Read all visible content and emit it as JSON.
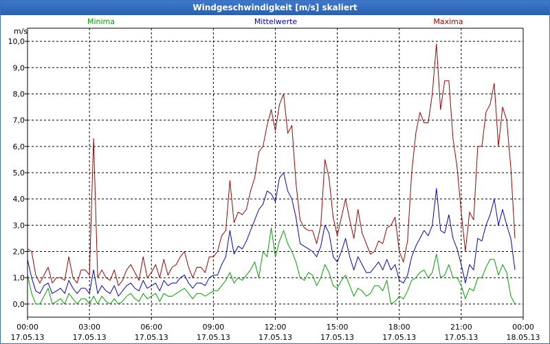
{
  "title": "Windgeschwindigkeit [m/s] skaliert",
  "colors": {
    "titlebar": "#2f68b8",
    "minima": "#00a000",
    "mittelwerte": "#0000c8",
    "maxima": "#a00000"
  },
  "chart_data": {
    "type": "line",
    "title": "Windgeschwindigkeit [m/s] skaliert",
    "ylabel": "m/s",
    "ylim": [
      -0.5,
      10.5
    ],
    "xlim": [
      0,
      24
    ],
    "grid": true,
    "legend_placement": "top",
    "y_ticks": [
      "0,0",
      "1,0",
      "2,0",
      "3,0",
      "4,0",
      "5,0",
      "6,0",
      "7,0",
      "8,0",
      "9,0",
      "10,0"
    ],
    "x_ticks": [
      {
        "time": "00:00",
        "date": "17.05.13"
      },
      {
        "time": "03:00",
        "date": "17.05.13"
      },
      {
        "time": "06:00",
        "date": "17.05.13"
      },
      {
        "time": "09:00",
        "date": "17.05.13"
      },
      {
        "time": "12:00",
        "date": "17.05.13"
      },
      {
        "time": "15:00",
        "date": "17.05.13"
      },
      {
        "time": "18:00",
        "date": "17.05.13"
      },
      {
        "time": "21:00",
        "date": "17.05.13"
      },
      {
        "time": "00:00",
        "date": "18.05.13"
      }
    ],
    "x_hours": [
      0,
      0.2,
      0.4,
      0.6,
      0.8,
      1,
      1.2,
      1.4,
      1.6,
      1.8,
      2,
      2.2,
      2.4,
      2.6,
      2.8,
      3,
      3.2,
      3.4,
      3.6,
      3.8,
      4,
      4.2,
      4.4,
      4.6,
      4.8,
      5,
      5.2,
      5.4,
      5.6,
      5.8,
      6,
      6.2,
      6.4,
      6.6,
      6.8,
      7,
      7.2,
      7.4,
      7.6,
      7.8,
      8,
      8.2,
      8.4,
      8.6,
      8.8,
      9,
      9.2,
      9.4,
      9.6,
      9.8,
      10,
      10.2,
      10.4,
      10.6,
      10.8,
      11,
      11.2,
      11.4,
      11.6,
      11.8,
      12,
      12.2,
      12.4,
      12.6,
      12.8,
      13,
      13.2,
      13.4,
      13.6,
      13.8,
      14,
      14.2,
      14.4,
      14.6,
      14.8,
      15,
      15.2,
      15.4,
      15.6,
      15.8,
      16,
      16.2,
      16.4,
      16.6,
      16.8,
      17,
      17.2,
      17.4,
      17.6,
      17.8,
      18,
      18.2,
      18.4,
      18.6,
      18.8,
      19,
      19.2,
      19.4,
      19.6,
      19.8,
      20,
      20.2,
      20.4,
      20.6,
      20.8,
      21,
      21.2,
      21.4,
      21.6,
      21.8,
      22,
      22.2,
      22.4,
      22.6,
      22.8,
      23,
      23.2,
      23.4,
      23.6,
      23.8,
      24
    ],
    "series": [
      {
        "name": "Maxima",
        "color": "#a00000",
        "values": [
          2.1,
          2.0,
          1.1,
          0.8,
          1.1,
          1.4,
          0.8,
          1.0,
          1.0,
          0.9,
          1.8,
          1.0,
          0.8,
          1.3,
          1.3,
          1.1,
          6.3,
          1.0,
          1.3,
          1.0,
          0.9,
          1.3,
          0.7,
          0.9,
          1.3,
          1.5,
          1.2,
          0.9,
          1.8,
          1.0,
          1.2,
          1.5,
          1.0,
          1.7,
          1.1,
          1.4,
          1.5,
          1.8,
          2.0,
          1.4,
          1.0,
          1.4,
          1.4,
          1.2,
          1.8,
          1.8,
          2.0,
          2.6,
          2.8,
          4.7,
          3.1,
          3.5,
          3.4,
          3.6,
          4.3,
          4.8,
          5.8,
          6.0,
          6.8,
          7.4,
          6.6,
          7.6,
          8.0,
          6.5,
          6.8,
          4.6,
          3.2,
          2.9,
          2.8,
          2.8,
          2.3,
          3.0,
          5.5,
          4.8,
          3.3,
          2.6,
          3.3,
          4.0,
          3.2,
          2.5,
          3.6,
          2.7,
          2.3,
          1.9,
          2.0,
          2.4,
          2.3,
          2.9,
          3.0,
          3.3,
          2.0,
          1.6,
          2.4,
          5.0,
          6.5,
          7.3,
          6.9,
          6.9,
          8.0,
          9.9,
          7.4,
          8.5,
          8.5,
          6.3,
          5.2,
          3.5,
          2.0,
          3.5,
          3.2,
          6.0,
          6.0,
          7.3,
          7.6,
          8.4,
          6.0,
          7.5,
          7.0,
          5.2,
          2.5
        ]
      },
      {
        "name": "Mittelwerte",
        "color": "#0000c8",
        "values": [
          1.7,
          1.0,
          0.5,
          0.4,
          0.7,
          0.8,
          0.4,
          0.5,
          0.6,
          0.4,
          0.9,
          0.6,
          0.4,
          0.6,
          0.6,
          0.4,
          1.3,
          0.4,
          0.7,
          0.5,
          0.4,
          0.7,
          0.3,
          0.5,
          0.7,
          0.8,
          0.6,
          0.5,
          0.9,
          0.6,
          0.7,
          0.8,
          0.5,
          0.9,
          0.7,
          0.8,
          0.8,
          1.0,
          1.1,
          0.8,
          0.6,
          0.8,
          0.8,
          0.7,
          1.0,
          1.1,
          1.1,
          1.5,
          1.8,
          2.8,
          1.9,
          2.2,
          2.1,
          2.4,
          2.8,
          3.2,
          3.6,
          3.8,
          4.3,
          4.2,
          3.9,
          4.8,
          5.0,
          4.3,
          4.0,
          3.3,
          2.3,
          2.2,
          2.1,
          2.0,
          1.8,
          2.2,
          3.0,
          2.7,
          1.8,
          1.6,
          2.0,
          2.5,
          1.8,
          1.3,
          1.8,
          1.5,
          1.2,
          1.2,
          1.4,
          1.6,
          1.3,
          1.7,
          1.3,
          1.5,
          0.9,
          0.8,
          1.1,
          1.8,
          2.2,
          2.5,
          2.8,
          2.6,
          3.0,
          4.4,
          2.8,
          2.7,
          3.4,
          2.5,
          2.1,
          1.5,
          0.8,
          1.5,
          1.3,
          2.5,
          2.4,
          3.0,
          3.4,
          4.0,
          3.0,
          3.6,
          3.0,
          2.5,
          1.3
        ]
      },
      {
        "name": "Minima",
        "color": "#00a000",
        "values": [
          1.1,
          0.4,
          0.0,
          0.0,
          0.3,
          0.6,
          0.0,
          0.1,
          0.2,
          0.0,
          0.4,
          0.2,
          0.0,
          0.2,
          0.2,
          0.0,
          0.3,
          0.0,
          0.3,
          0.1,
          0.0,
          0.2,
          0.0,
          0.1,
          0.3,
          0.4,
          0.2,
          0.1,
          0.4,
          0.2,
          0.3,
          0.4,
          0.1,
          0.4,
          0.3,
          0.3,
          0.4,
          0.5,
          0.6,
          0.4,
          0.2,
          0.4,
          0.4,
          0.3,
          0.4,
          0.5,
          0.5,
          0.7,
          0.9,
          1.2,
          0.8,
          1.0,
          0.9,
          1.1,
          1.3,
          1.6,
          1.0,
          2.0,
          1.8,
          2.9,
          1.8,
          2.4,
          2.8,
          2.3,
          2.0,
          1.6,
          1.0,
          0.9,
          1.2,
          1.1,
          0.7,
          1.0,
          1.5,
          1.2,
          0.7,
          0.6,
          0.9,
          1.1,
          0.7,
          0.3,
          0.6,
          0.5,
          0.3,
          0.4,
          0.7,
          0.7,
          0.5,
          0.9,
          0.0,
          0.1,
          0.3,
          0.2,
          0.5,
          0.9,
          1.0,
          1.2,
          1.3,
          1.0,
          1.2,
          1.9,
          1.0,
          1.1,
          1.5,
          1.0,
          1.0,
          0.7,
          0.2,
          0.6,
          0.5,
          1.0,
          1.0,
          1.4,
          1.7,
          1.7,
          1.1,
          1.5,
          1.2,
          0.3,
          0.0
        ]
      }
    ]
  }
}
